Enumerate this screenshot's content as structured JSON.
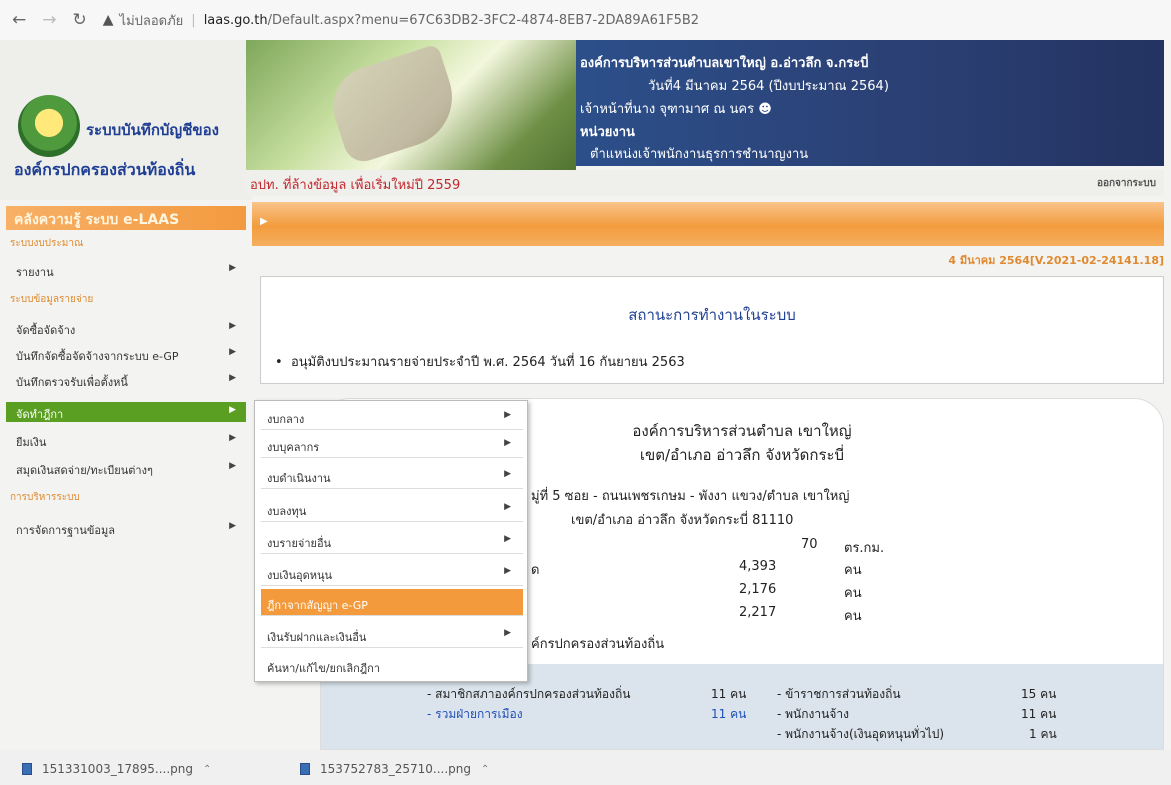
{
  "browser": {
    "insecure_label": "ไม่ปลอดภัย",
    "host": "laas.go.th",
    "path": "/Default.aspx?menu=67C63DB2-3FC2-4874-8EB7-2DA89A61F5B2"
  },
  "header": {
    "logo_line1": "ระบบบันทึกบัญชีของ",
    "logo_line2": "องค์กรปกครองส่วนท้องถิ่น",
    "org": "องค์การบริหารส่วนตำบลเขาใหญ่ อ.อ่าวลึก จ.กระบี่",
    "date": "วันที่4 มีนาคม 2564  (ปีงบประมาณ 2564)",
    "officer": "เจ้าหน้าที่นาง จุฑามาศ ณ นคร",
    "unit": "หน่วยงาน",
    "position": "ตำแหน่งเจ้าพนักงานธุรการชำนาญงาน",
    "notice": "อปท. ที่ล้างข้อมูล เพื่อเริ่มใหม่ปี 2559",
    "logout": "ออกจากระบบ",
    "version": "4 มีนาคม 2564[V.2021-02-24141.18]"
  },
  "sidebar": {
    "banner": "คลังความรู้ ระบบ e-LAAS",
    "sections": [
      "ระบบงบประมาณ",
      "ระบบข้อมูลรายจ่าย",
      "การบริหารระบบ"
    ],
    "items": [
      "รายงาน",
      "จัดซื้อจัดจ้าง",
      "บันทึกจัดซื้อจัดจ้างจากระบบ e-GP",
      "บันทึกตรวจรับเพื่อตั้งหนี้",
      "จัดทำฎีกา",
      "ยืมเงิน",
      "สมุดเงินสดจ่าย/ทะเบียนต่างๆ",
      "การจัดการฐานข้อมูล"
    ]
  },
  "submenu": {
    "items": [
      "งบกลาง",
      "งบบุคลากร",
      "งบดำเนินงาน",
      "งบลงทุน",
      "งบรายจ่ายอื่น",
      "งบเงินอุดหนุน",
      "ฎีกาจากสัญญา e-GP",
      "เงินรับฝากและเงินอื่น",
      "ค้นหา/แก้ไข/ยกเลิกฎีกา"
    ]
  },
  "status": {
    "title": "สถานะการทำงานในระบบ",
    "bullet": "อนุมัติงบประมาณรายจ่ายประจำปี พ.ศ. 2564 วันที่ 16 กันยายน 2563"
  },
  "org_info": {
    "title": "องค์การบริหารส่วนตำบล เขาใหญ่",
    "subtitle": "เขต/อำเภอ อ่าวลึก  จังหวัดกระบี่",
    "address1": "มู่ที่ 5  ซอย -  ถนนเพชรเกษม - พังงา  แขวง/ตำบล เขาใหญ่",
    "address2": "เขต/อำเภอ อ่าวลึก  จังหวัดกระบี่  81110",
    "area_value": "70",
    "area_unit": "ตร.กม.",
    "pop_total_frag": "ด",
    "pop_total": "4,393",
    "pop_male": "2,176",
    "pop_female": "2,217",
    "person_unit": "คน",
    "council_heading_frag": "ค์กรปกครองส่วนท้องถิ่น",
    "council_members": "- สมาชิกสภาองค์กรปกครองส่วนท้องถิ่น",
    "council_members_count": "11 คน",
    "political_staff": "- รวมฝ่ายการเมือง",
    "political_staff_count": "11 คน",
    "civil_servants": "- ข้าราชการส่วนท้องถิ่น",
    "civil_servants_count": "15 คน",
    "employees": "- พนักงานจ้าง",
    "employees_count": "11 คน",
    "employees_subsidy": "- พนักงานจ้าง(เงินอุดหนุนทั่วไป)",
    "employees_subsidy_count": "1 คน"
  },
  "downloads": [
    "151331003_17895....png",
    "153752783_25710....png"
  ]
}
